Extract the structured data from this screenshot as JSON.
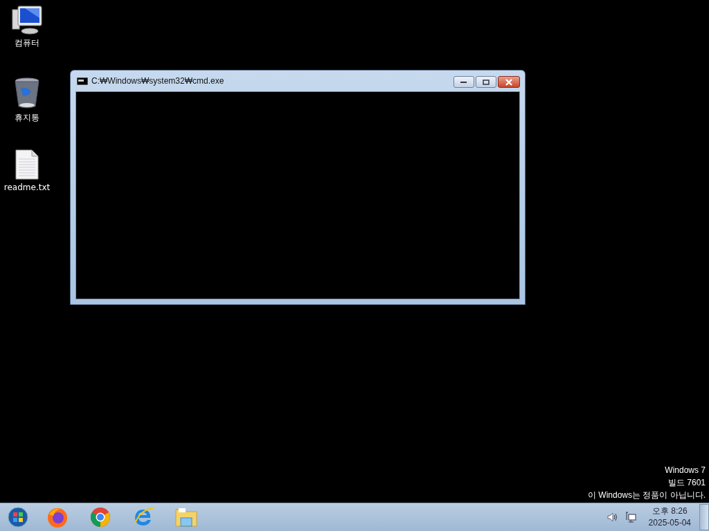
{
  "desktop_icons": [
    {
      "kind": "computer",
      "label": "컴퓨터"
    },
    {
      "kind": "recycle-bin",
      "label": "휴지통"
    },
    {
      "kind": "text-file",
      "label": "readme.txt"
    }
  ],
  "window": {
    "title": "C:₩Windows₩system32₩cmd.exe"
  },
  "desktop_notice": [
    "Windows 7",
    "빌드 7601",
    "이 Windows는 정품이 아닙니다."
  ],
  "taskbar": {
    "pinned": [
      {
        "kind": "firefox"
      },
      {
        "kind": "chrome"
      },
      {
        "kind": "ie"
      },
      {
        "kind": "explorer"
      }
    ],
    "clock": {
      "time": "오후 8:26",
      "date": "2025-05-04"
    }
  }
}
